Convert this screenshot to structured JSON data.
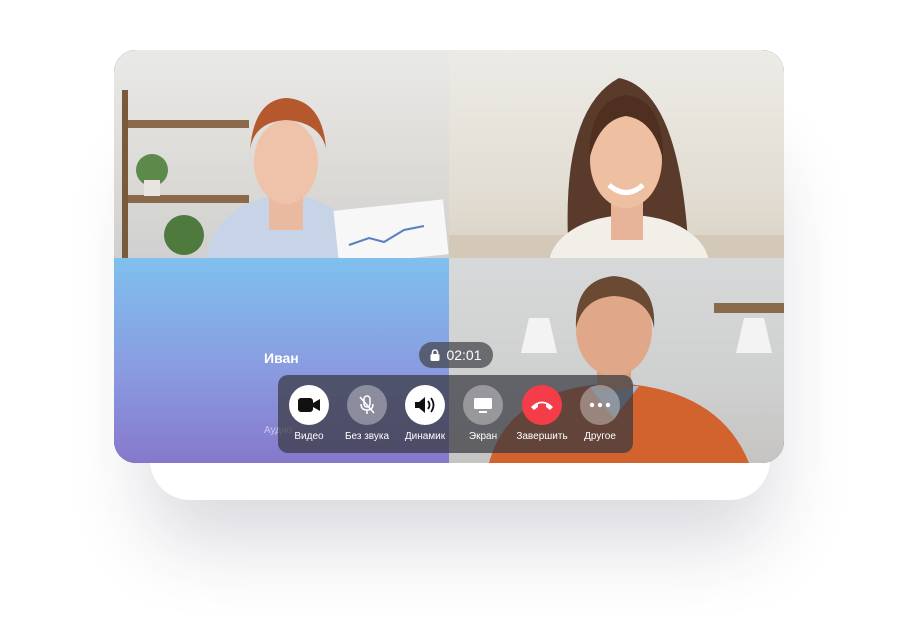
{
  "call": {
    "timer": "02:01",
    "participant": {
      "name": "Иван",
      "sub": "Аудио"
    }
  },
  "controls": [
    {
      "id": "video",
      "label": "Видео",
      "icon": "video-camera-icon",
      "style": "white"
    },
    {
      "id": "mute",
      "label": "Без звука",
      "icon": "mic-off-icon",
      "style": "grey"
    },
    {
      "id": "speaker",
      "label": "Динамик",
      "icon": "speaker-icon",
      "style": "white"
    },
    {
      "id": "screen",
      "label": "Экран",
      "icon": "monitor-icon",
      "style": "grey"
    },
    {
      "id": "end",
      "label": "Завершить",
      "icon": "hang-up-icon",
      "style": "red"
    },
    {
      "id": "more",
      "label": "Другое",
      "icon": "more-icon",
      "style": "grey"
    }
  ],
  "colors": {
    "end_call": "#f43d48",
    "avatar_gradient_top": "#7fc0ee",
    "avatar_gradient_bottom": "#8678cc"
  }
}
